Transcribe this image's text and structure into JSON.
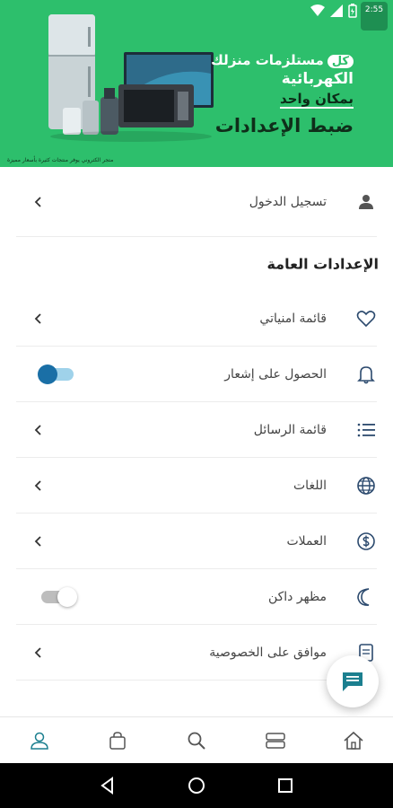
{
  "banner": {
    "promo_prefix": "كل",
    "promo_line1": "مستلزمات منزلك",
    "promo_line2": "الكهربائية",
    "promo_line3": "بمكان واحد",
    "title": "ضبط الإعدادات",
    "fine_print": "متجر الكتروني يوفر منتجات كثيرة بأسعار مميزة",
    "logo_text": "2:55",
    "brand_color": "#2dbf6c"
  },
  "login": {
    "label": "تسجيل الدخول",
    "icon": "user-icon"
  },
  "general": {
    "title": "الإعدادات العامة",
    "items": [
      {
        "label": "قائمة امنياتي",
        "icon": "heart-icon",
        "control": "chevron"
      },
      {
        "label": "الحصول على إشعار",
        "icon": "bell-icon",
        "control": "toggle-on"
      },
      {
        "label": "قائمة الرسائل",
        "icon": "list-icon",
        "control": "chevron"
      },
      {
        "label": "اللغات",
        "icon": "globe-icon",
        "control": "chevron"
      },
      {
        "label": "العملات",
        "icon": "dollar-icon",
        "control": "chevron"
      },
      {
        "label": "مظهر داكن",
        "icon": "moon-icon",
        "control": "toggle-off"
      },
      {
        "label": "موافق على الخصوصية",
        "icon": "document-icon",
        "control": "chevron"
      }
    ]
  },
  "nav": [
    "profile-icon",
    "bag-icon",
    "search-icon",
    "categories-icon",
    "home-icon"
  ],
  "colors": {
    "accent": "#1a6fa6",
    "icon": "#2c4a6e",
    "teal": "#1b7f8f"
  }
}
